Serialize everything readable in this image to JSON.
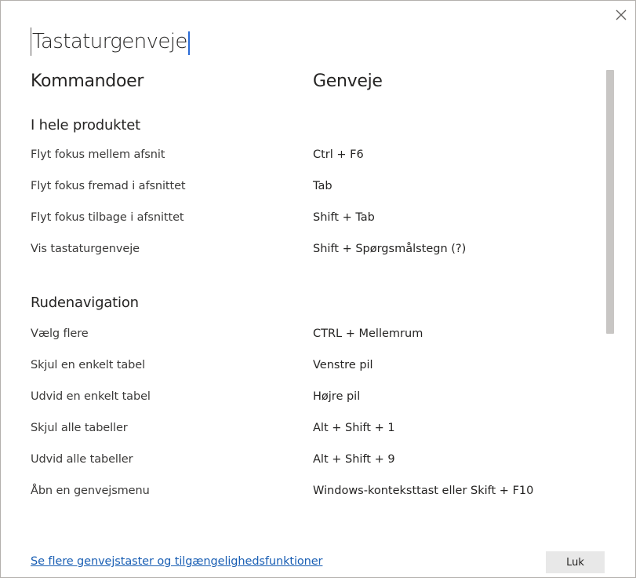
{
  "dialog": {
    "title": "Tastaturgenveje",
    "close_icon": "close-icon"
  },
  "columns": {
    "commands": "Kommandoer",
    "shortcuts": "Genveje"
  },
  "sections": [
    {
      "title": "I hele produktet",
      "rows": [
        {
          "command": "Flyt fokus mellem afsnit",
          "shortcut": "Ctrl + F6"
        },
        {
          "command": "Flyt fokus fremad i afsnittet",
          "shortcut": "Tab"
        },
        {
          "command": "Flyt fokus tilbage i afsnittet",
          "shortcut": "Shift + Tab"
        },
        {
          "command": "Vis tastaturgenveje",
          "shortcut": "Shift + Spørgsmålstegn (?)"
        }
      ]
    },
    {
      "title": "Rudenavigation",
      "rows": [
        {
          "command": "Vælg flere",
          "shortcut": "CTRL + Mellemrum"
        },
        {
          "command": "Skjul en enkelt tabel",
          "shortcut": "Venstre pil"
        },
        {
          "command": "Udvid en enkelt tabel",
          "shortcut": "Højre pil"
        },
        {
          "command": "Skjul alle tabeller",
          "shortcut": "Alt + Shift + 1"
        },
        {
          "command": "Udvid alle tabeller",
          "shortcut": "Alt + Shift + 9"
        },
        {
          "command": "Åbn en genvejsmenu",
          "shortcut": "Windows-kontekst­tast eller Skift + F10"
        }
      ]
    }
  ],
  "footer": {
    "link_text": "Se flere genvejstaster og tilgængelighedsfunktioner",
    "close_button_label": "Luk"
  }
}
